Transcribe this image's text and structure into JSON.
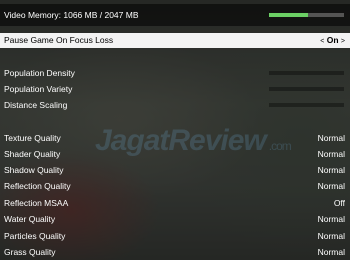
{
  "video_memory": {
    "label": "Video Memory: 1066 MB / 2047 MB",
    "used_mb": 1066,
    "total_mb": 2047,
    "bar_color": "#6cd065"
  },
  "pause_on_focus_loss": {
    "label": "Pause Game On Focus Loss",
    "value": "On",
    "left_arrow": "<",
    "right_arrow": ">"
  },
  "population_settings": [
    {
      "label": "Population Density"
    },
    {
      "label": "Population Variety"
    },
    {
      "label": "Distance Scaling"
    }
  ],
  "quality_settings": [
    {
      "label": "Texture Quality",
      "value": "Normal"
    },
    {
      "label": "Shader Quality",
      "value": "Normal"
    },
    {
      "label": "Shadow Quality",
      "value": "Normal"
    },
    {
      "label": "Reflection Quality",
      "value": "Normal"
    },
    {
      "label": "Reflection MSAA",
      "value": "Off"
    },
    {
      "label": "Water Quality",
      "value": "Normal"
    },
    {
      "label": "Particles Quality",
      "value": "Normal"
    },
    {
      "label": "Grass Quality",
      "value": "Normal"
    }
  ],
  "watermark": {
    "brand": "JagatReview",
    "suffix": ".com"
  },
  "colors": {
    "selected_row_bg": "#f3f3f3",
    "accent_green": "#6cd065"
  }
}
